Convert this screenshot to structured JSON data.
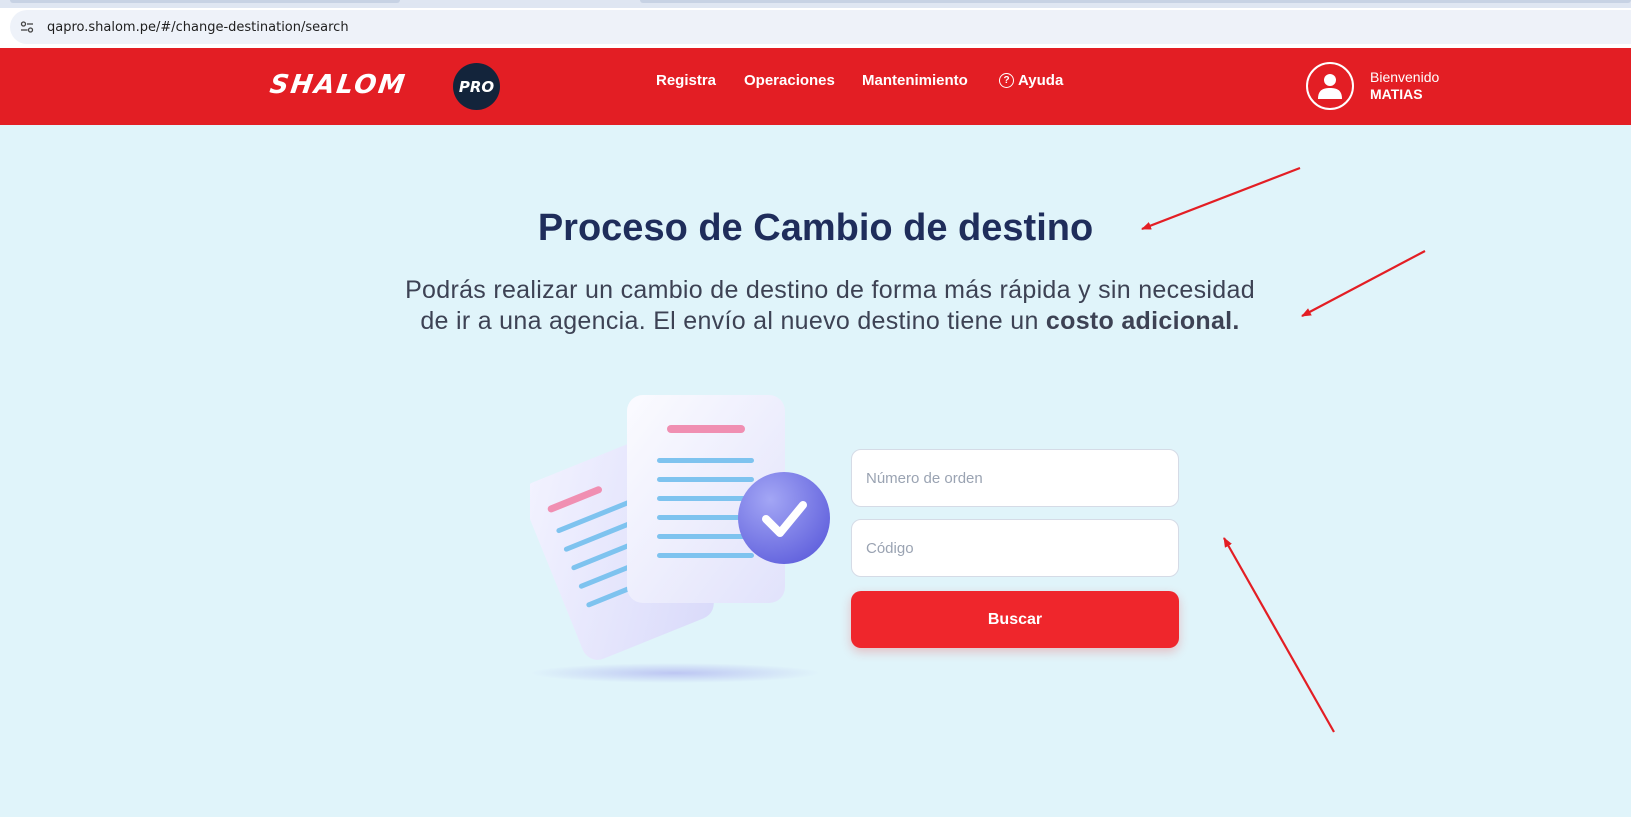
{
  "browser": {
    "url": "qapro.shalom.pe/#/change-destination/search"
  },
  "header": {
    "logo_text": "SHALOM",
    "logo_badge": "PRO",
    "nav": {
      "registra": "Registra",
      "operaciones": "Operaciones",
      "mantenimiento": "Mantenimiento",
      "ayuda": "Ayuda",
      "help_icon_glyph": "?"
    },
    "user": {
      "greeting": "Bienvenido",
      "name": "MATIAS"
    }
  },
  "main": {
    "title_prefix": "Proceso de ",
    "title_bold": "Cambio de destino",
    "subtitle_text": "Podrás realizar un cambio de destino de forma más rápida y sin necesidad de ir a una agencia. El envío al nuevo destino tiene un ",
    "subtitle_bold": "costo adicional."
  },
  "form": {
    "order_placeholder": "Número de orden",
    "code_placeholder": "Código",
    "search_button": "Buscar"
  },
  "colors": {
    "brand_red": "#e31e24",
    "background": "#e0f4fa",
    "title_navy": "#1f2d5b",
    "button_red": "#ef262c"
  }
}
